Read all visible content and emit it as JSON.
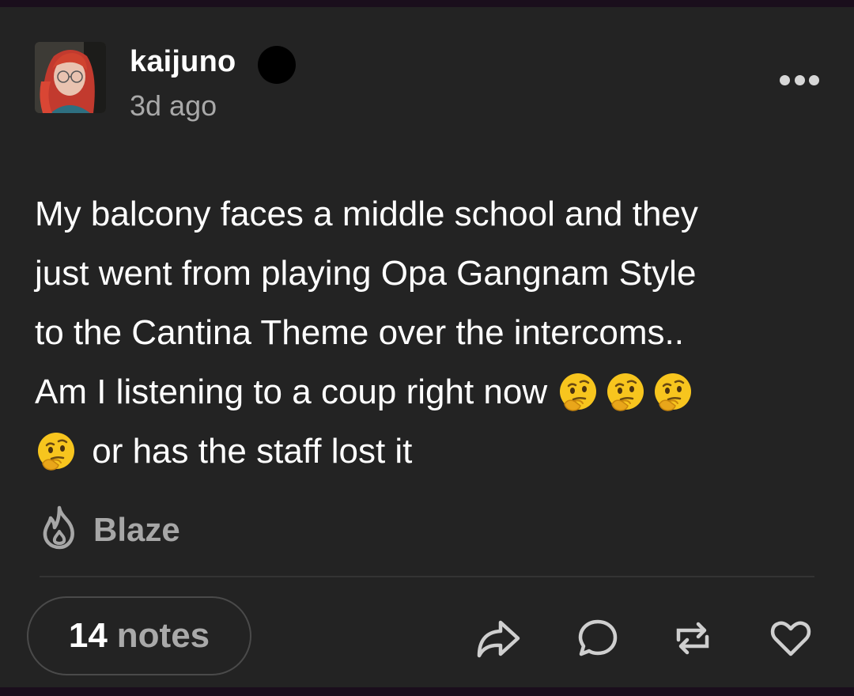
{
  "post": {
    "username": "kaijuno",
    "timestamp": "3d ago",
    "lines": [
      {
        "text": "My balcony faces a middle school and they",
        "lead_emoji": 0,
        "trail_emoji": 0
      },
      {
        "text": "just went from playing Opa Gangnam Style",
        "lead_emoji": 0,
        "trail_emoji": 0
      },
      {
        "text": "to the Cantina Theme over the intercoms..",
        "lead_emoji": 0,
        "trail_emoji": 0
      },
      {
        "text": "Am I listening to a coup right now ",
        "lead_emoji": 0,
        "trail_emoji": 3
      },
      {
        "text": " or has the staff lost it",
        "lead_emoji": 1,
        "trail_emoji": 0
      }
    ],
    "emoji_name": "thinking-face-emoji"
  },
  "blaze": {
    "label": "Blaze",
    "icon": "flame-icon"
  },
  "footer": {
    "notes_count": "14",
    "notes_label": "notes",
    "actions": [
      "share-icon",
      "reply-icon",
      "reblog-icon",
      "like-icon"
    ]
  },
  "colors": {
    "background": "#232323",
    "frame": "#1a0e1c",
    "muted_text": "#a9a9a9",
    "emoji_yellow": "#f7c51e"
  }
}
